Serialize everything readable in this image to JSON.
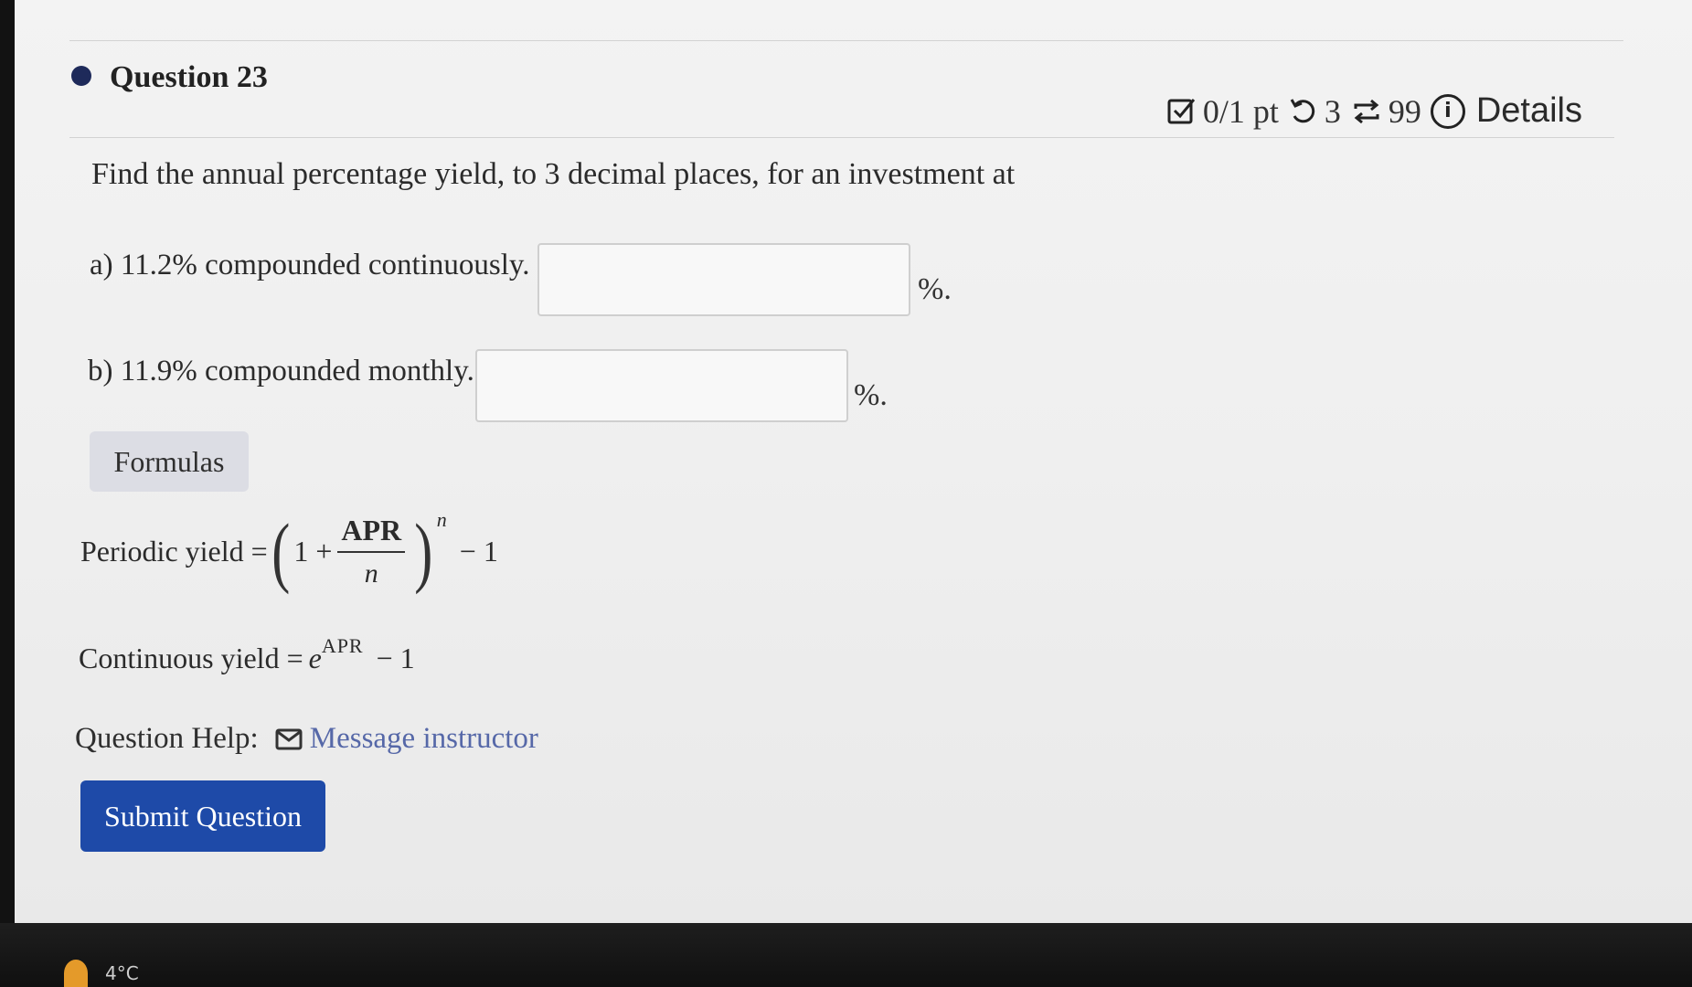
{
  "question": {
    "title": "Question 23",
    "score": "0/1 pt",
    "attempts": "3",
    "versions": "99",
    "details_label": "Details",
    "prompt": "Find the annual percentage yield, to 3 decimal places, for an investment at"
  },
  "parts": [
    {
      "label": "a) 11.2% compounded continuously.",
      "value": "",
      "suffix": "%."
    },
    {
      "label": "b) 11.9% compounded monthly.",
      "value": "",
      "suffix": "%."
    }
  ],
  "formulas": {
    "button_label": "Formulas",
    "periodic": {
      "label": "Periodic yield =",
      "one_plus": "1 +",
      "numerator": "APR",
      "denominator": "n",
      "exponent": "n",
      "tail": "− 1"
    },
    "continuous": {
      "label": "Continuous yield =",
      "base": "e",
      "exponent": "APR",
      "tail": "− 1"
    }
  },
  "help": {
    "label": "Question Help:",
    "link": "Message instructor"
  },
  "submit_label": "Submit Question",
  "taskbar": {
    "temperature": "4°C"
  },
  "colors": {
    "submit": "#1e4aa8",
    "link": "#5668a8",
    "formulas_bg": "#dcdde4"
  }
}
